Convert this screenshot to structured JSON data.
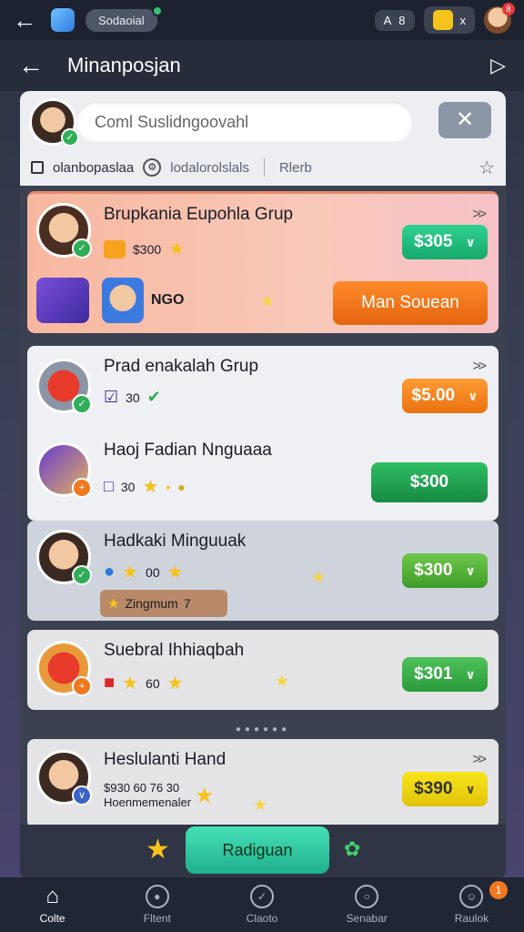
{
  "statusbar": {
    "app_pill": "Sodaoial",
    "chip_left": "A",
    "chip_left_count": "8",
    "chip_right_count": "x",
    "avatar_badge": "8"
  },
  "header": {
    "title": "Minanposjan"
  },
  "search": {
    "placeholder": "Coml Suslidngoovahl"
  },
  "filters": {
    "item1": "olanbopaslaa",
    "item2": "lodalorolslals",
    "item3": "Rlerb"
  },
  "cards": [
    {
      "name": "Brupkania Eupohla Grup",
      "sub_value": "$300",
      "label2": "NGO",
      "price": "$305",
      "action": "Man Souean"
    },
    {
      "name": "Prad enakalah Grup",
      "sub_value": "30",
      "price": "$5.00"
    },
    {
      "name": "Haoj Fadian Nnguaaa",
      "sub_value": "30",
      "price": "$300"
    },
    {
      "name": "Hadkaki Minguuak",
      "sub_value": "00",
      "tag": "Zingmum",
      "tag_count": "7",
      "price": "$300"
    },
    {
      "name": "Suebral Ihhiaqbah",
      "sub_value": "60",
      "price": "$301"
    },
    {
      "name": "Heslulanti Hand",
      "line1": "$930 60 76 30",
      "line2": "Hoenmemenaler",
      "price": "$390"
    }
  ],
  "cta": {
    "label": "Radiguan"
  },
  "nav": [
    {
      "label": "Colte"
    },
    {
      "label": "Fltent"
    },
    {
      "label": "Claoto"
    },
    {
      "label": "Senabar"
    },
    {
      "label": "Raulok",
      "badge": "1"
    }
  ],
  "colors": {
    "accent_green": "#2fae57",
    "accent_orange": "#f0781f",
    "accent_yellow": "#f6c21c",
    "accent_teal": "#1fb08d"
  }
}
